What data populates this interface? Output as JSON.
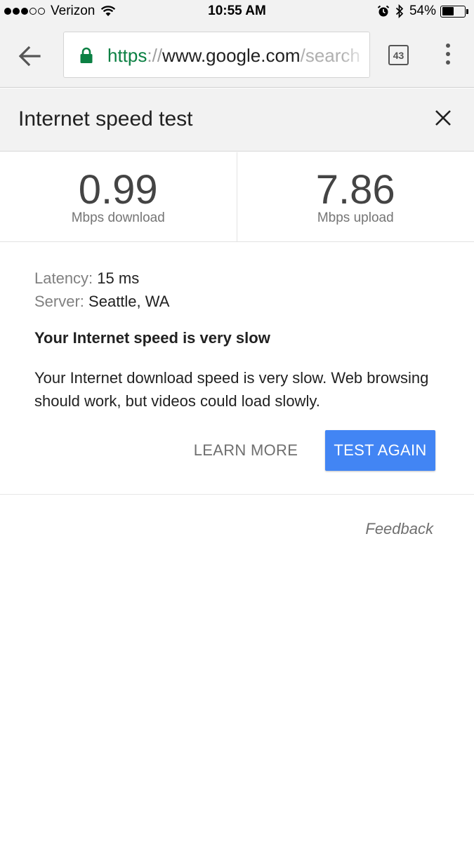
{
  "status_bar": {
    "signal_dots_filled": 3,
    "signal_dots_total": 5,
    "carrier": "Verizon",
    "time": "10:55 AM",
    "battery_percent": "54%",
    "battery_level": 0.54,
    "icons": [
      "wifi-icon",
      "alarm-icon",
      "bluetooth-icon",
      "battery-icon"
    ]
  },
  "toolbar": {
    "url_scheme": "https",
    "url_separator": "://",
    "url_host": "www.google.com",
    "url_path": "/search",
    "tab_count": "43",
    "secure_color": "#0b8043"
  },
  "card": {
    "title": "Internet speed test",
    "download_value": "0.99",
    "download_unit": "Mbps download",
    "upload_value": "7.86",
    "upload_unit": "Mbps upload",
    "latency_label": "Latency:",
    "latency_value": "15 ms",
    "server_label": "Server:",
    "server_value": "Seattle, WA",
    "verdict": "Your Internet speed is very slow",
    "description": "Your Internet download speed is very slow. Web browsing should work, but videos could load slowly.",
    "learn_more_label": "LEARN MORE",
    "test_again_label": "TEST AGAIN",
    "feedback_label": "Feedback",
    "accent_color": "#4285f4"
  }
}
